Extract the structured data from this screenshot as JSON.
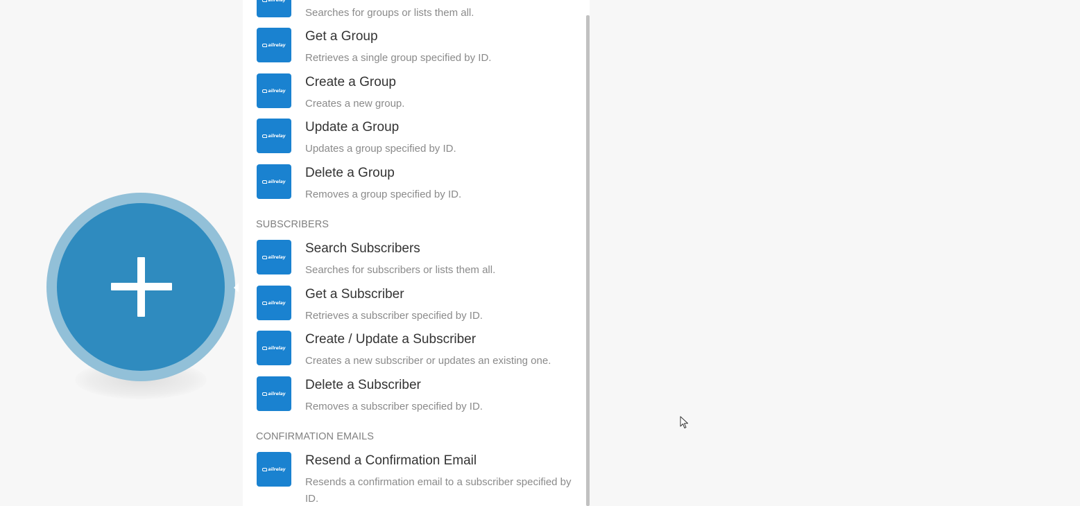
{
  "module_bubble": {
    "icon": "plus-icon"
  },
  "panel": {
    "items_top": [
      {
        "title": "",
        "desc": "Searches for groups or lists them all."
      },
      {
        "title": "Get a Group",
        "desc": "Retrieves a single group specified by ID."
      },
      {
        "title": "Create a Group",
        "desc": "Creates a new group."
      },
      {
        "title": "Update a Group",
        "desc": "Updates a group specified by ID."
      },
      {
        "title": "Delete a Group",
        "desc": "Removes a group specified by ID."
      }
    ],
    "section_subscribers": "SUBSCRIBERS",
    "items_subscribers": [
      {
        "title": "Search Subscribers",
        "desc": "Searches for subscribers or lists them all."
      },
      {
        "title": "Get a Subscriber",
        "desc": "Retrieves a subscriber specified by ID."
      },
      {
        "title": "Create / Update a Subscriber",
        "desc": "Creates a new subscriber or updates an existing one."
      },
      {
        "title": "Delete a Subscriber",
        "desc": "Removes a subscriber specified by ID."
      }
    ],
    "section_confirmation": "CONFIRMATION EMAILS",
    "items_confirmation": [
      {
        "title": "Resend a Confirmation Email",
        "desc": "Resends a confirmation email to a subscriber specified by ID."
      }
    ],
    "app_logo_text": "ailrelay"
  },
  "colors": {
    "bubble_outer": "#92c0d8",
    "bubble_inner": "#2f8bbf",
    "app_icon": "#1a82d0",
    "title_text": "#333333",
    "desc_text": "#8a8a8a",
    "section_text": "#808080",
    "background": "#f7f7f7"
  }
}
